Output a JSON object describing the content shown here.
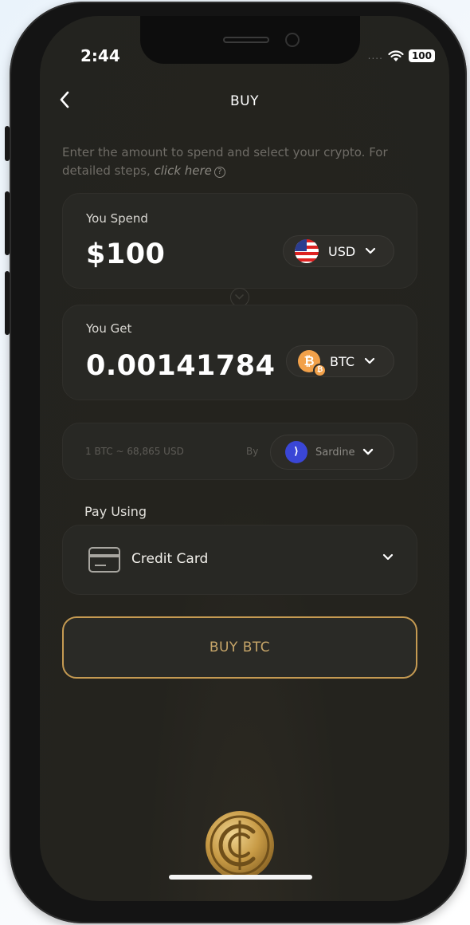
{
  "status": {
    "time": "2:44",
    "signal": "....",
    "battery": "100"
  },
  "header": {
    "title": "BUY"
  },
  "intro": {
    "text": "Enter the amount to spend and select your crypto. For detailed steps, ",
    "link": "click here"
  },
  "spend": {
    "label": "You Spend",
    "amount": "$100",
    "currency": "USD"
  },
  "get": {
    "label": "You Get",
    "amount": "0.00141784",
    "currency": "BTC"
  },
  "rate": {
    "text": "1 BTC ~ 68,865 USD",
    "by_label": "By",
    "provider": "Sardine"
  },
  "payment": {
    "label": "Pay Using",
    "method": "Credit Card"
  },
  "buy_button": {
    "label": "BUY BTC"
  },
  "colors": {
    "accent": "#c59a52",
    "background": "#24231f",
    "card": "#282824",
    "btc": "#f2a14a",
    "sardine": "#3a46d6"
  },
  "icons": [
    "back-chevron-icon",
    "us-flag-icon",
    "chevron-down-icon",
    "bitcoin-icon",
    "swap-icon",
    "sardine-icon",
    "credit-card-icon",
    "brand-logo-icon",
    "wifi-icon"
  ]
}
